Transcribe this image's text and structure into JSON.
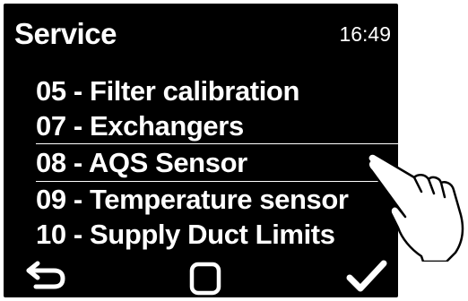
{
  "header": {
    "title": "Service",
    "time": "16:49"
  },
  "menu": {
    "items": [
      {
        "label": "05 - Filter calibration"
      },
      {
        "label": "07 - Exchangers"
      },
      {
        "label": "08 - AQS Sensor"
      },
      {
        "label": "09 - Temperature sensor"
      },
      {
        "label": "10 - Supply Duct Limits"
      }
    ],
    "selected_index": 2
  },
  "footer": {
    "buttons": [
      {
        "icon": "back-arrow-icon"
      },
      {
        "icon": "square-icon"
      },
      {
        "icon": "checkmark-icon"
      }
    ]
  },
  "colors": {
    "screen_background": "#000000",
    "text": "#ffffff",
    "page_background": "#ffffff"
  }
}
